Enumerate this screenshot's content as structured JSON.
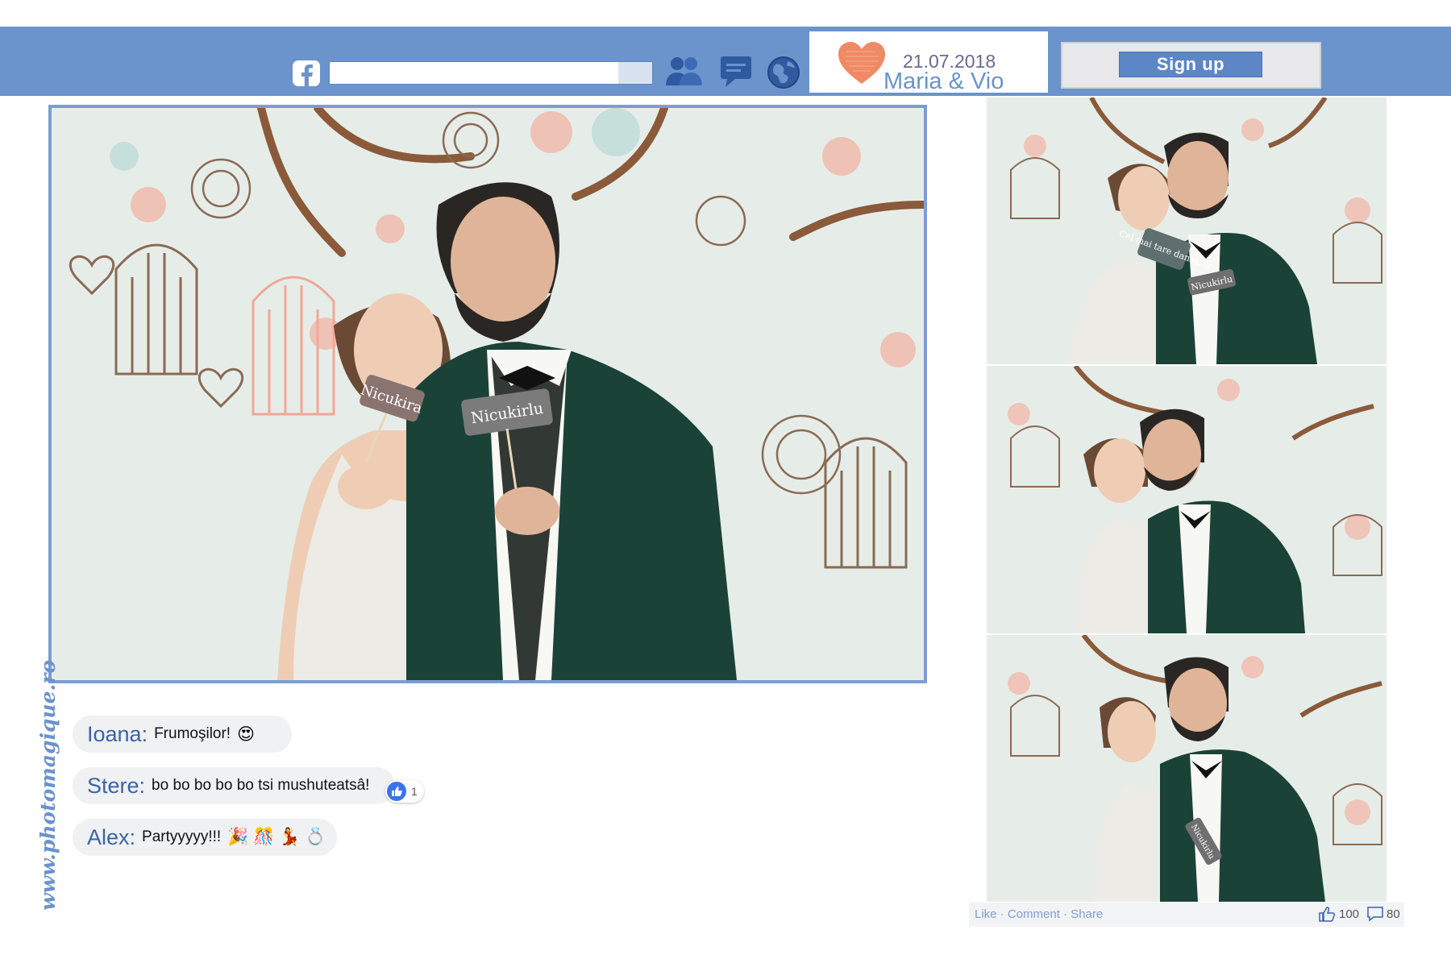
{
  "header": {
    "search_placeholder": "",
    "event": {
      "date": "21.07.2018",
      "names": "Maria & Vio"
    },
    "signup_label": "Sign up"
  },
  "icons": {
    "logo": "facebook-icon",
    "nav": [
      "friends-icon",
      "messages-icon",
      "globe-icon"
    ],
    "event": "heart-icon"
  },
  "photos": {
    "main": {
      "props": [
        "Nicukira",
        "Nicukirlu"
      ]
    },
    "strip": [
      {
        "props": [
          "Cel mai tare dansator",
          "Nicukirlu"
        ]
      },
      {
        "props": []
      },
      {
        "props": [
          "Nicukirlu"
        ]
      }
    ]
  },
  "comments": [
    {
      "name": "Ioana:",
      "text": "Frumoşilor!",
      "emoji": "😍"
    },
    {
      "name": "Stere:",
      "text": "bo bo bo bo bo tsi mushuteatsâ!",
      "emoji": ""
    },
    {
      "name": "Alex:",
      "text": "Partyyyyy!!!",
      "emoji": "🎉 🎊 💃 💍"
    }
  ],
  "reactions": {
    "stere_likes": "1"
  },
  "footer": {
    "links": "Like · Comment · Share",
    "likes": "100",
    "comments": "80"
  },
  "watermark": "www.photomagique.ro",
  "colors": {
    "bar": "#6b93cc",
    "accent": "#f08a64",
    "text_blue": "#3b63a8"
  }
}
